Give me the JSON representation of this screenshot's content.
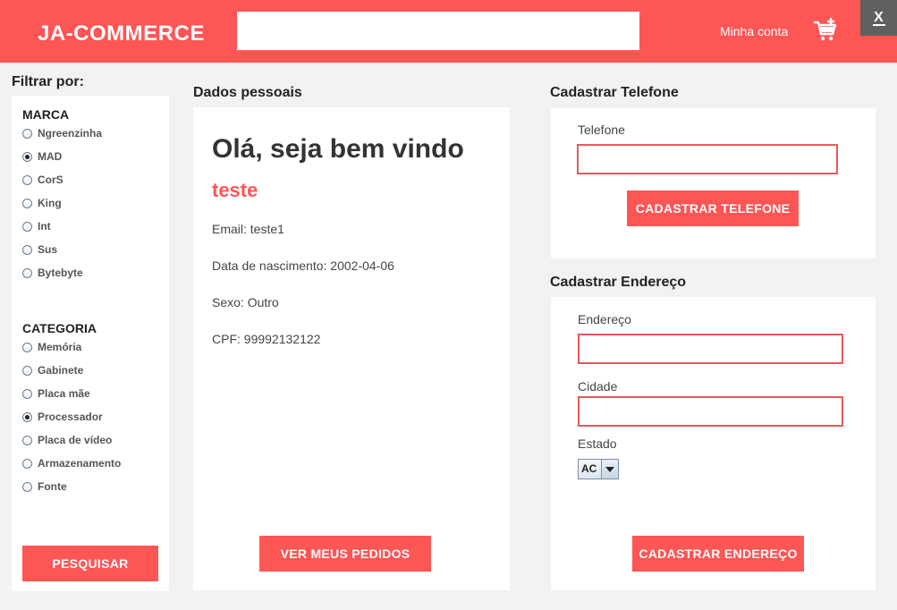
{
  "header": {
    "brand": "JA-COMMERCE",
    "search_placeholder": "",
    "account_label": "Minha conta",
    "cart_icon": "cart-add-icon",
    "close_label": "X"
  },
  "filter": {
    "title": "Filtrar por:",
    "brand_title": "MARCA",
    "brands": [
      {
        "label": "Ngreenzinha",
        "checked": false
      },
      {
        "label": "MAD",
        "checked": true
      },
      {
        "label": "CorS",
        "checked": false
      },
      {
        "label": "King",
        "checked": false
      },
      {
        "label": "Int",
        "checked": false
      },
      {
        "label": "Sus",
        "checked": false
      },
      {
        "label": "Bytebyte",
        "checked": false
      }
    ],
    "category_title": "CATEGORIA",
    "categories": [
      {
        "label": "Memória",
        "checked": false
      },
      {
        "label": "Gabinete",
        "checked": false
      },
      {
        "label": "Placa mãe",
        "checked": false
      },
      {
        "label": "Processador",
        "checked": true
      },
      {
        "label": "Placa de vídeo",
        "checked": false
      },
      {
        "label": "Armazenamento",
        "checked": false
      },
      {
        "label": "Fonte",
        "checked": false
      }
    ],
    "search_button": "PESQUISAR"
  },
  "personal": {
    "title": "Dados pessoais",
    "welcome": "Olá, seja bem vindo",
    "username": "teste",
    "email": "Email: teste1",
    "birth": "Data de nascimento: 2002-04-06",
    "sex": "Sexo: Outro",
    "cpf": "CPF: 99992132122",
    "orders_button": "VER MEUS PEDIDOS"
  },
  "phone": {
    "title": "Cadastrar Telefone",
    "label": "Telefone",
    "value": "",
    "button": "CADASTRAR TELEFONE"
  },
  "address": {
    "title": "Cadastrar Endereço",
    "address_label": "Endereço",
    "address_value": "",
    "city_label": "Cidade",
    "city_value": "",
    "state_label": "Estado",
    "state_value": "AC",
    "button": "CADASTRAR ENDEREÇO"
  },
  "colors": {
    "accent": "#fe5555",
    "background": "#f2f2f2",
    "close_bg": "#606060"
  }
}
